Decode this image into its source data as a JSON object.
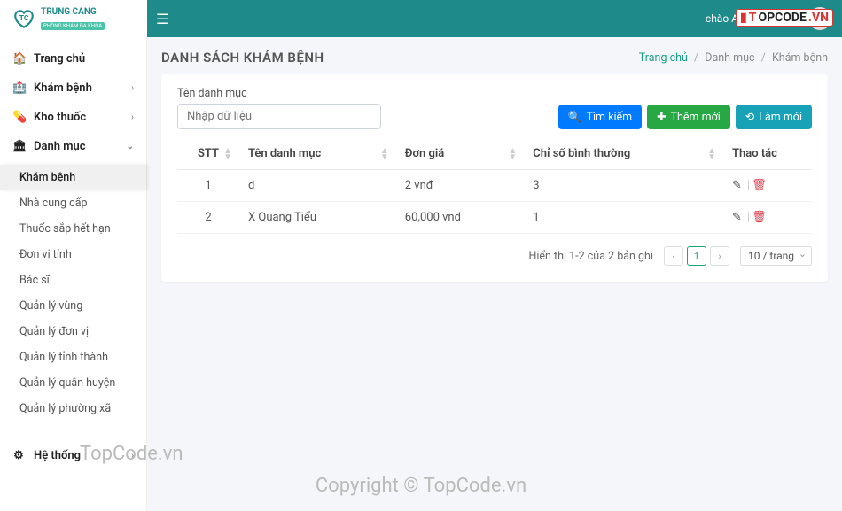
{
  "brand": {
    "name": "TRUNG CANG",
    "tagline": "PHÒNG KHÁM ĐA KHOA"
  },
  "topbar": {
    "greeting": "chào Administrator !"
  },
  "sidebar": {
    "items": [
      {
        "label": "Trang chủ",
        "icon": "🏠"
      },
      {
        "label": "Khám bệnh",
        "icon": "🏥"
      },
      {
        "label": "Kho thuốc",
        "icon": "💊"
      },
      {
        "label": "Danh mục",
        "icon": "🏛"
      }
    ],
    "danhmuc_sub": [
      {
        "label": "Khám bệnh"
      },
      {
        "label": "Nhà cung cấp"
      },
      {
        "label": "Thuốc sắp hết hạn"
      },
      {
        "label": "Đơn vị tính"
      },
      {
        "label": "Bác sĩ"
      },
      {
        "label": "Quản lý vùng"
      },
      {
        "label": "Quản lý đơn vị"
      },
      {
        "label": "Quản lý tỉnh thành"
      },
      {
        "label": "Quản lý quận huyện"
      },
      {
        "label": "Quản lý phường xã"
      }
    ],
    "hethong": {
      "label": "Hệ thống",
      "icon": "⚙"
    }
  },
  "page": {
    "title": "DANH SÁCH KHÁM BỆNH",
    "breadcrumb": {
      "home": "Trang chủ",
      "group": "Danh mục",
      "current": "Khám bệnh"
    }
  },
  "filter": {
    "label": "Tên danh mục",
    "placeholder": "Nhập dữ liệu",
    "search_btn": "Tìm kiếm",
    "add_btn": "Thêm mới",
    "refresh_btn": "Làm mới"
  },
  "table": {
    "headers": {
      "stt": "STT",
      "ten": "Tên danh mục",
      "gia": "Đơn giá",
      "chiso": "Chỉ số bình thường",
      "thaotac": "Thao tác"
    },
    "rows": [
      {
        "stt": "1",
        "ten": "d",
        "gia": "2 vnđ",
        "chiso": "3"
      },
      {
        "stt": "2",
        "ten": "X Quang Tiểu",
        "gia": "60,000 vnđ",
        "chiso": "1"
      }
    ]
  },
  "pager": {
    "summary": "Hiển thị 1-2 của 2 bản ghi",
    "page": "1",
    "per_page": "10 / trang"
  },
  "watermark": {
    "a": "TopCode.vn",
    "b": "Copyright © TopCode.vn",
    "badge_pre": "T",
    "badge_mid": "OPCODE",
    "badge_suf": ".VN"
  }
}
